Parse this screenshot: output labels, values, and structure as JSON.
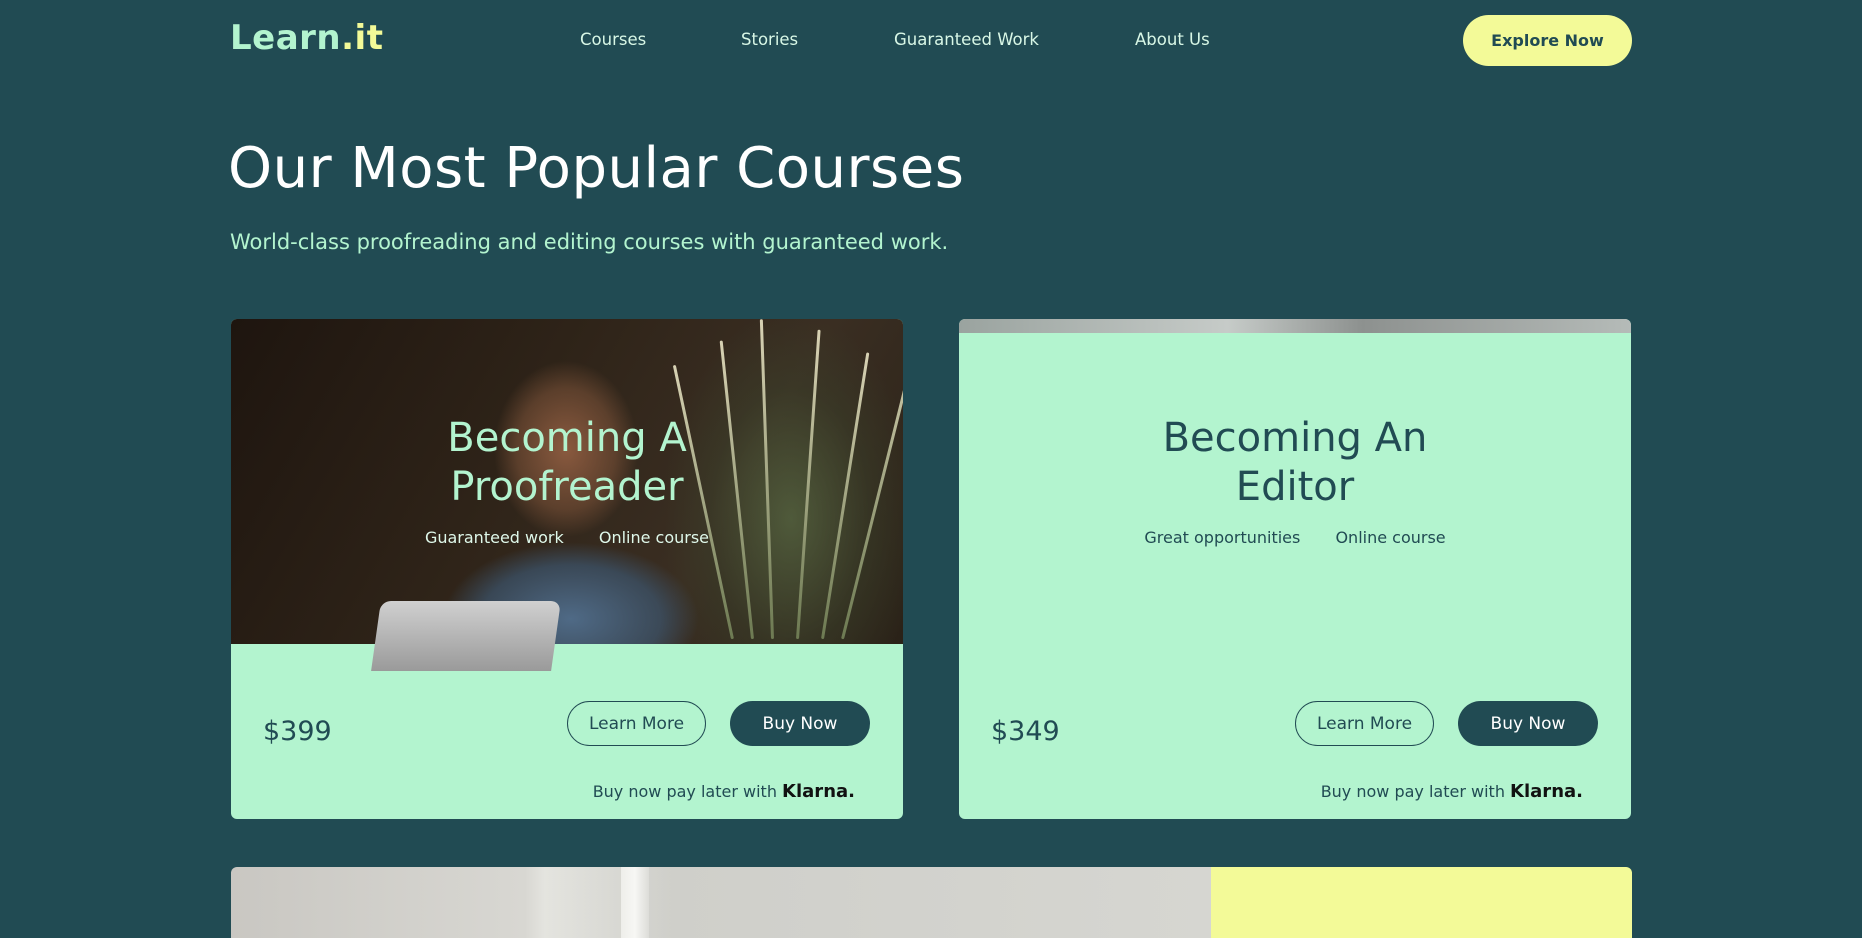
{
  "header": {
    "logo_word": "Learn",
    "logo_suffix": ".it",
    "nav": [
      "Courses",
      "Stories",
      "Guaranteed Work",
      "About Us"
    ],
    "cta_label": "Explore Now"
  },
  "hero": {
    "title": "Our Most Popular Courses",
    "subtitle": "World-class proofreading and editing courses with guaranteed work."
  },
  "courses": [
    {
      "title_line1": "Becoming A",
      "title_line2": "Proofreader",
      "tags": [
        "Guaranteed work",
        "Online course"
      ],
      "price": "$399",
      "learn_label": "Learn More",
      "buy_label": "Buy Now",
      "klarna_text": "Buy now pay later with",
      "klarna_brand": "Klarna."
    },
    {
      "title_line1": "Becoming An",
      "title_line2": "Editor",
      "tags": [
        "Great opportunities",
        "Online course"
      ],
      "price": "$349",
      "learn_label": "Learn More",
      "buy_label": "Buy Now",
      "klarna_text": "Buy now pay later with",
      "klarna_brand": "Klarna."
    }
  ],
  "colors": {
    "background": "#214b53",
    "mint": "#b3f4cf",
    "yellow": "#f3fa98"
  }
}
